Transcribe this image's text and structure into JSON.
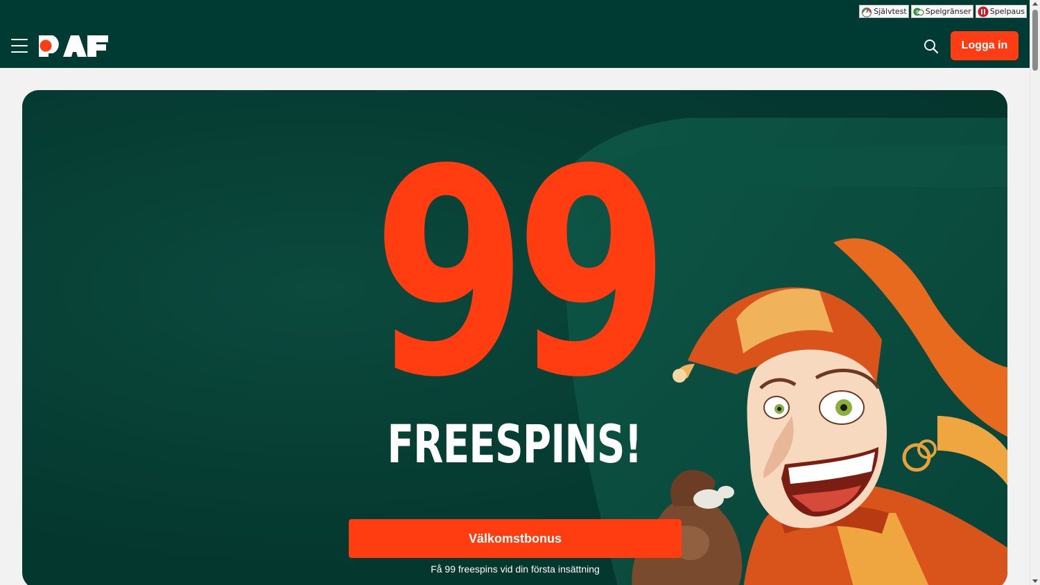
{
  "header": {
    "responsible_gaming": [
      {
        "label": "Självtest",
        "icon": "gauge-icon"
      },
      {
        "label": "Spelgränser",
        "icon": "limits-icon"
      },
      {
        "label": "Spelpaus",
        "icon": "pause-icon"
      }
    ],
    "menu_icon": "hamburger-menu-icon",
    "logo_text": "PAF",
    "search_icon": "search-icon",
    "login_label": "Logga in"
  },
  "hero": {
    "headline_number": "99",
    "headline_text": "FREESPINS!",
    "cta_label": "Välkomstbonus",
    "cta_subtext": "Få 99 freespins vid din första insättning"
  },
  "colors": {
    "header_bg": "#003b33",
    "accent": "#ff3d10",
    "hero_bg": "#053a30",
    "text_light": "#ffffff"
  }
}
